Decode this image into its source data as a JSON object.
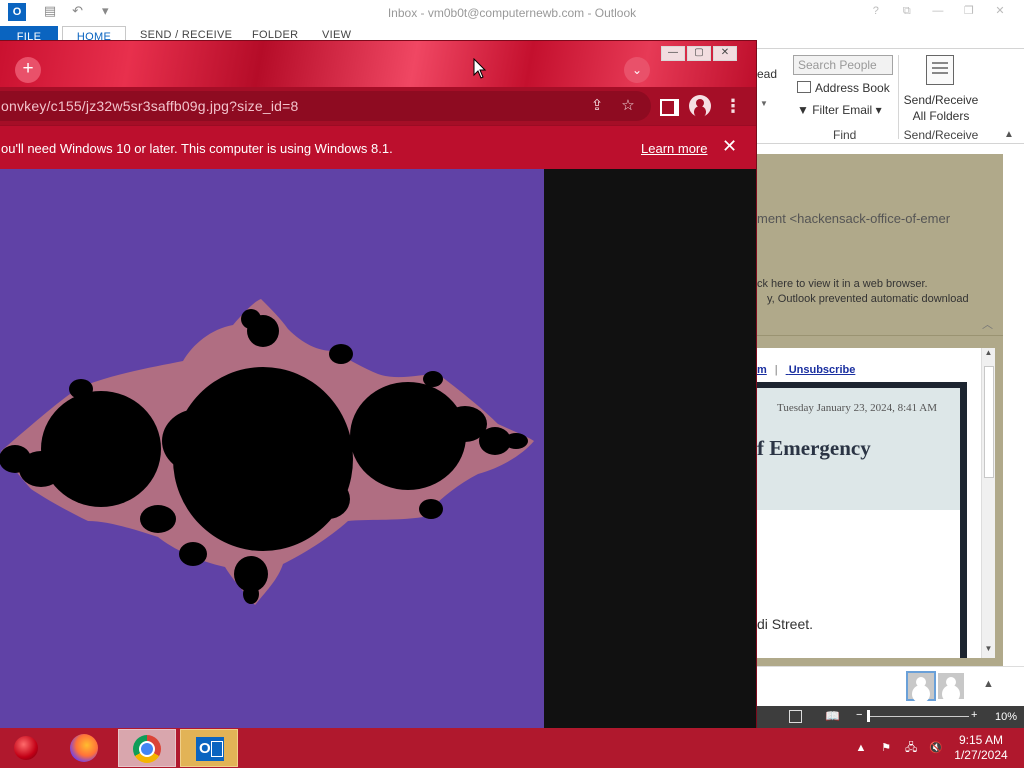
{
  "outlook": {
    "title": "Inbox - vm0b0t@computernewb.com - Outlook",
    "app_icon": "O",
    "qat_icons": [
      "save-icon",
      "undo-icon",
      "customize-icon"
    ],
    "window_controls": [
      "?",
      "⧉",
      "—",
      "❐",
      "✕"
    ],
    "tabs": [
      "FILE",
      "HOME",
      "SEND / RECEIVE",
      "FOLDER",
      "VIEW"
    ],
    "ribbon": {
      "lead_label": "ead",
      "search_people_placeholder": "Search People",
      "address_book": "Address Book",
      "filter_email": "Filter Email",
      "group_find": "Find",
      "send_receive_all": "Send/Receive All Folders",
      "group_send_receive": "Send/Receive"
    },
    "reading": {
      "from": "ment <hackensack-office-of-emer",
      "info_line1": "ck here to view it in a web browser.",
      "info_line2": "y, Outlook prevented automatic download",
      "link_1": "m",
      "link_2": "Unsubscribe",
      "date": "Tuesday January 23, 2024, 8:41 AM",
      "heading": "f Emergency",
      "street": "di Street."
    },
    "status": {
      "zoom_minus": "−",
      "zoom_plus": "+",
      "zoom_level": "10%",
      "zoom_fraction": 0.02
    }
  },
  "chrome": {
    "url": "onvkey/c155/jz32w5sr3saffb09g.jpg?size_id=8",
    "new_tab_icon": "+",
    "tab_search_icon": "⌄",
    "window_buttons": [
      "—",
      "▢",
      "✕"
    ],
    "infobar_text": "ou'll need Windows 10 or later. This computer is using Windows 8.1.",
    "learn_more": "Learn more",
    "infobar_close": "✕",
    "menu_icon": "⋮"
  },
  "taskbar": {
    "time": "9:15 AM",
    "date": "1/27/2024",
    "tray_icons": [
      "show-hidden-icons-icon",
      "action-center-icon",
      "network-icon",
      "volume-muted-icon"
    ]
  },
  "colors": {
    "chrome_theme": "#c1112f",
    "image_background": "#6042a6",
    "fractal_body": "#000000",
    "fractal_edge": "#b06e82",
    "outlook_accent": "#0a64c0"
  }
}
